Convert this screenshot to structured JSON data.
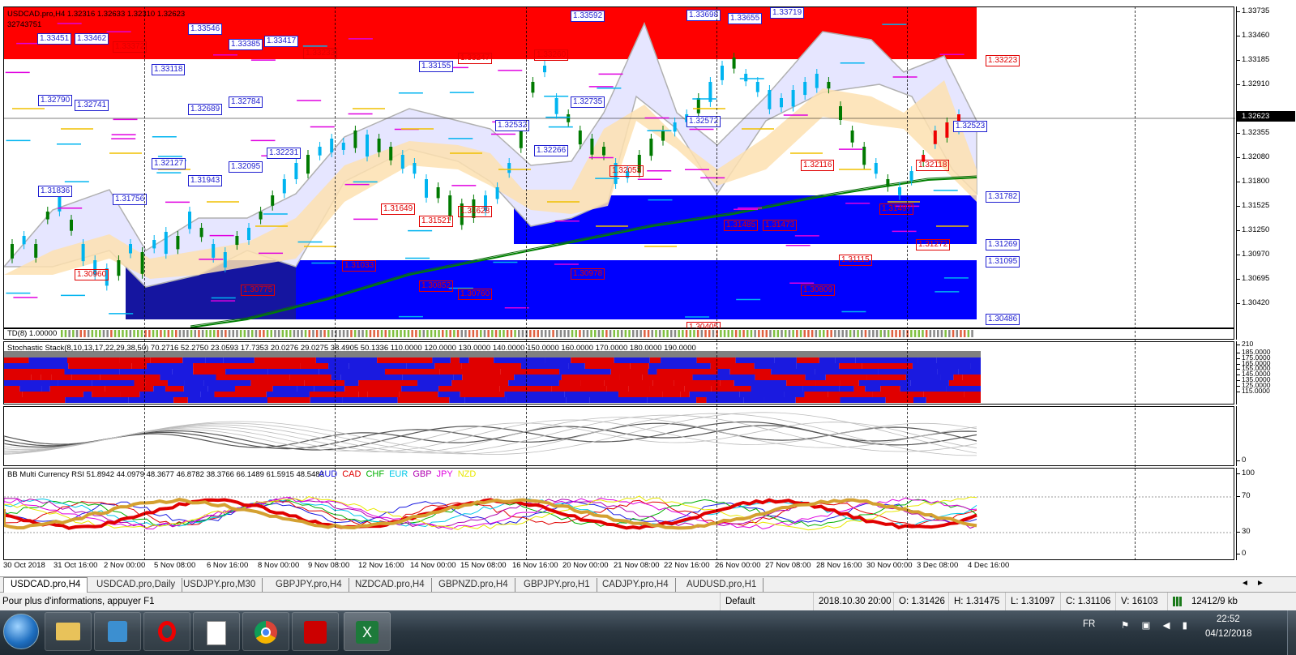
{
  "chart": {
    "title": "USDCAD.pro,H4  1.32316 1.32633 1.32310 1.32623",
    "subtitle": "32743751",
    "current_price": "1.32623",
    "price_ticks": [
      "1.33735",
      "1.33460",
      "1.33185",
      "1.32910",
      "1.32623",
      "1.32355",
      "1.32080",
      "1.31800",
      "1.31525",
      "1.31250",
      "1.30970",
      "1.30695",
      "1.30420"
    ],
    "blue_labels": [
      "1.33451",
      "1.33462",
      "1.33546",
      "1.33385",
      "1.33417",
      "1.33592",
      "1.33698",
      "1.33655",
      "1.33719",
      "1.33118",
      "1.33155",
      "1.32790",
      "1.32741",
      "1.32689",
      "1.32784",
      "1.32735",
      "1.32532",
      "1.32572",
      "1.32523",
      "1.32231",
      "1.32266",
      "1.32127",
      "1.32095",
      "1.31943",
      "1.31836",
      "1.31756",
      "1.31782",
      "1.31269",
      "1.31095",
      "1.30486"
    ],
    "red_labels": [
      "1.33372",
      "1.33233",
      "1.33247",
      "1.33260",
      "1.33223",
      "1.32053",
      "1.32116",
      "1.32118",
      "1.31649",
      "1.31628",
      "1.31521",
      "1.31485",
      "1.31473",
      "1.31497",
      "1.31272",
      "1.31115",
      "1.31033",
      "1.30960",
      "1.30852",
      "1.30760",
      "1.30978",
      "1.30809",
      "1.30775",
      "1.30405"
    ]
  },
  "indicators": {
    "td": "TD(8) 1.00000",
    "stoch": "Stochastic Stack(8,10,13,17,22,29,38,50) 70.2716 52.2750 23.0593 17.7353 20.0276 29.0275 38.4905 50.1336 110.0000 120.0000 130.0000 140.0000 150.0000 160.0000 170.0000 180.0000 190.0000",
    "stoch_ticks": [
      "210",
      "185.0000",
      "175.0000",
      "165.0000",
      "155.0000",
      "145.0000",
      "135.0000",
      "125.0000",
      "115.0000"
    ],
    "osc_ticks": [
      "0"
    ],
    "rsi_title": "BB Multi Currency RSI 51.8942 44.0979 48.3677 46.8782 38.3766 66.1489 61.5915 48.5483",
    "rsi_legend": [
      {
        "name": "AUD",
        "color": "#1a1ae0"
      },
      {
        "name": "CAD",
        "color": "#e00000"
      },
      {
        "name": "CHF",
        "color": "#00b000"
      },
      {
        "name": "EUR",
        "color": "#00c8e8"
      },
      {
        "name": "GBP",
        "color": "#b000b0"
      },
      {
        "name": "JPY",
        "color": "#e000e0"
      },
      {
        "name": "NZD",
        "color": "#e8e800"
      }
    ],
    "rsi_ticks": [
      "100",
      "70",
      "30",
      "0"
    ]
  },
  "time_axis": [
    "30 Oct 2018",
    "31 Oct 16:00",
    "2 Nov 00:00",
    "5 Nov 08:00",
    "6 Nov 16:00",
    "8 Nov 00:00",
    "9 Nov 08:00",
    "12 Nov 16:00",
    "14 Nov 00:00",
    "15 Nov 08:00",
    "16 Nov 16:00",
    "20 Nov 00:00",
    "21 Nov 08:00",
    "22 Nov 16:00",
    "26 Nov 00:00",
    "27 Nov 08:00",
    "28 Nov 16:00",
    "30 Nov 00:00",
    "3 Dec 08:00",
    "4 Dec 16:00"
  ],
  "tabs": [
    "USDCAD.pro,H4",
    "USDCAD.pro,Daily",
    "USDJPY.pro,M30",
    "GBPJPY.pro,H4",
    "NZDCAD.pro,H4",
    "GBPNZD.pro,H4",
    "GBPJPY.pro,H1",
    "CADJPY.pro,H4",
    "AUDUSD.pro,H1"
  ],
  "status": {
    "help": "Pour plus d'informations, appuyer F1",
    "profile": "Default",
    "datetime": "2018.10.30 20:00",
    "open": "O: 1.31426",
    "high": "H: 1.31475",
    "low": "L: 1.31097",
    "close": "C: 1.31106",
    "volume": "V: 16103",
    "traffic": "12412/9 kb"
  },
  "taskbar": {
    "lang": "FR",
    "time": "22:52",
    "date": "04/12/2018",
    "apps": [
      "start-orb",
      "file-explorer",
      "media-player",
      "opera",
      "notepad",
      "chrome",
      "acrobat",
      "excel"
    ]
  },
  "colors": {
    "supply_zone": "#ff0000",
    "demand_zone": "#0000ff",
    "bull_candle": "#007a00",
    "bear_candle": "#00b4f0",
    "ma": "#008000"
  }
}
